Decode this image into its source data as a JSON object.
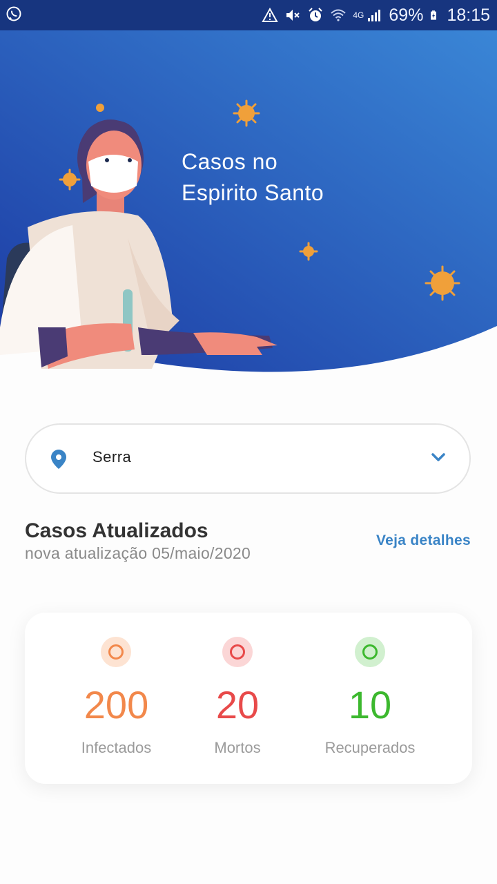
{
  "status_bar": {
    "battery": "69%",
    "time": "18:15",
    "network": "4G",
    "icons": [
      "whatsapp-icon",
      "warning-icon",
      "mute-icon",
      "alarm-icon",
      "wifi-icon",
      "signal-icon",
      "battery-icon"
    ]
  },
  "hero": {
    "title_line1": "Casos no",
    "title_line2": "Espirito Santo",
    "gradient_start": "#1c3aa3",
    "gradient_end": "#3a86d6"
  },
  "location": {
    "selected": "Serra",
    "icon": "location-pin-icon",
    "chevron": "chevron-down-icon"
  },
  "cases": {
    "title": "Casos Atualizados",
    "updated": "nova atualização 05/maio/2020",
    "details_link": "Veja detalhes",
    "stats": [
      {
        "value": "200",
        "label": "Infectados",
        "color": "#f2884b"
      },
      {
        "value": "20",
        "label": "Mortos",
        "color": "#e84a4a"
      },
      {
        "value": "10",
        "label": "Recuperados",
        "color": "#3cb82e"
      }
    ]
  }
}
